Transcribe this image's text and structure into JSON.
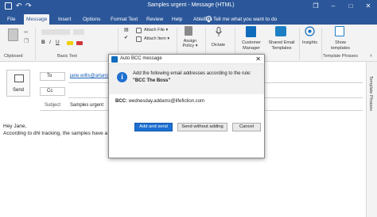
{
  "titlebar": {
    "title": "Samples urgent - Message (HTML)",
    "undo_icon": "↶",
    "redo_icon": "↷",
    "restore_icon": "❐",
    "minimize_icon": "–",
    "maximize_icon": "□",
    "close_icon": "✕"
  },
  "tabs": [
    "File",
    "Message",
    "Insert",
    "Options",
    "Format Text",
    "Review",
    "Help",
    "AbleBits"
  ],
  "active_tab": "Message",
  "tell_me": "Tell me what you want to do",
  "ribbon": {
    "attach_file": "Attach File ▾",
    "attach_item": "Attach Item ▾",
    "assign_policy": "Assign Policy ▾",
    "dictate": "Dictate",
    "customer_manager": "Customer Manager",
    "shared_email_templates": "Shared Email Templates",
    "insights": "Insights",
    "show_templates": "Show templates",
    "groups": [
      "Clipboard",
      "Basic Text",
      "Template Phrases"
    ]
  },
  "compose": {
    "send_label": "Send",
    "to_label": "To",
    "cc_label": "Cc",
    "subject_label": "Subject",
    "to_value": "jane.willis@artand",
    "subject_value": "Samples urgent",
    "body_line1": "Hey Jane,",
    "body_line2": "According to dhl tracking, the samples have a"
  },
  "side_panel": {
    "label": "Template Phrases"
  },
  "dialog": {
    "title": "Auto BCC message",
    "close_icon": "✕",
    "info_icon": "i",
    "message": "Add the following email addresses according to the rule:",
    "rule": "\"BCC The Boss\"",
    "bcc_label": "BCC:",
    "bcc_value": "wednesday.addams@lifefiction.com",
    "buttons": {
      "add_send": "Add and send",
      "send_without": "Send without adding",
      "cancel": "Cancel"
    }
  },
  "colors": {
    "accent": "#2b579a",
    "button_primary": "#1e6fd0"
  }
}
